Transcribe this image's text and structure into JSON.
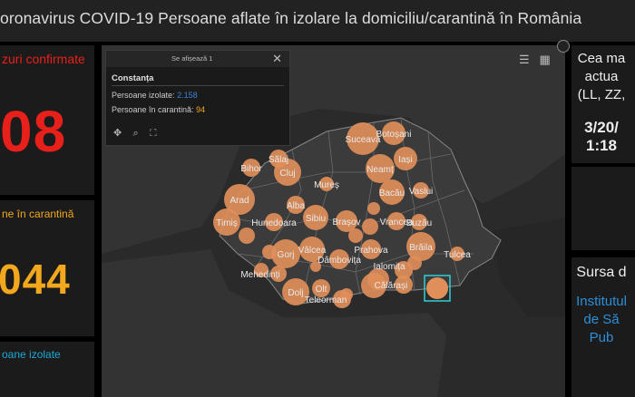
{
  "title": "oronavirus COVID-19 Persoane aflate în izolare la domiciliu/carantină în România",
  "left": {
    "confirmed_label": "zuri confirmate",
    "confirmed_value": "08",
    "quarantine_label": "ne în carantină",
    "quarantine_value": "044",
    "isolated_label": "oane izolate"
  },
  "popup": {
    "header": "Se afișează 1",
    "close": "✕",
    "county": "Constanța",
    "isolated_label": "Persoane izolate:",
    "isolated_value": "2.158",
    "quarantine_label": "Persoane în carantină:",
    "quarantine_value": "94"
  },
  "map": {
    "counties": [
      "Botoșani",
      "Suceava",
      "Sălaj",
      "Iași",
      "Bihor",
      "Cluj",
      "Neamț",
      "Mureș",
      "Bacău",
      "Vaslui",
      "Arad",
      "Alba",
      "Sibiu",
      "Brașov",
      "Vrancea",
      "Timiș",
      "Hunedoara",
      "Buzău",
      "Brăila",
      "Tulcea",
      "Gorj",
      "Vâlcea",
      "Prahova",
      "Dâmbovița",
      "Mehedinți",
      "Ialomița",
      "Olt",
      "Călărași",
      "Dolj",
      "Teleorman"
    ]
  },
  "right": {
    "update_line1": "Cea ma",
    "update_line2": "actua",
    "update_line3": "(LL, ZZ,",
    "update_date": "3/20/",
    "update_time": "1:18",
    "source_label": "Sursa d",
    "source_link1": "Institutul",
    "source_link2": "de Să",
    "source_link3": "Pub"
  },
  "colors": {
    "confirmed": "#e8201b",
    "quarantine": "#f2a81d",
    "isolated": "#1ea8d6",
    "bubble": "#e08e5a",
    "link": "#2d8fd9"
  }
}
